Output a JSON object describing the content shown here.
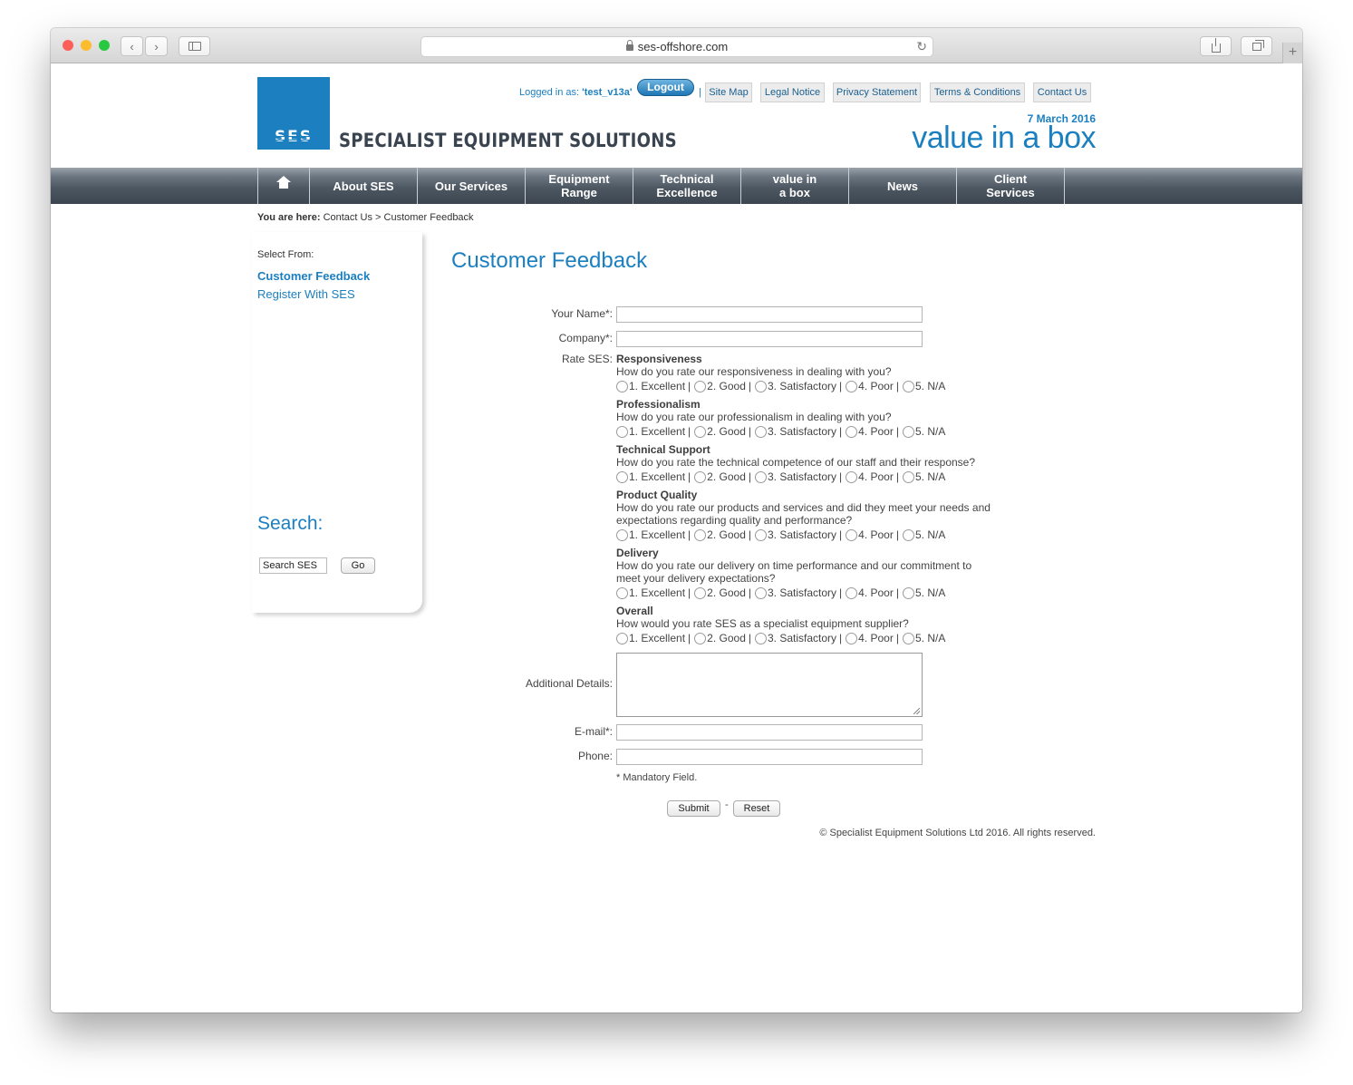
{
  "browser": {
    "url": "ses-offshore.com",
    "traffic_colors": [
      "#fc5f57",
      "#fdbc2e",
      "#28c840"
    ]
  },
  "header": {
    "logo_text": "SES",
    "brand_name": "SPECIALIST EQUIPMENT SOLUTIONS",
    "logged_in_prefix": "Logged in as: ",
    "logged_in_user": "'test_v13a'",
    "logout_label": "Logout",
    "separator": "|",
    "top_links": [
      "Site Map",
      "Legal Notice",
      "Privacy Statement",
      "Terms & Conditions",
      "Contact Us"
    ],
    "date": "7 March 2016",
    "tagline": "value in a box"
  },
  "nav": {
    "items": [
      "About SES",
      "Our Services",
      "Equipment Range",
      "Technical Excellence",
      "value in a box",
      "News",
      "Client Services"
    ]
  },
  "breadcrumb": {
    "prefix": "You are here:",
    "path": "Contact Us > Customer Feedback"
  },
  "sidebar": {
    "select_label": "Select From:",
    "links": [
      "Customer Feedback",
      "Register With SES"
    ],
    "search_title": "Search:",
    "search_value": "Search SES",
    "go_label": "Go"
  },
  "form": {
    "title": "Customer Feedback",
    "labels": {
      "name": "Your Name*:",
      "company": "Company*:",
      "rate": "Rate SES:",
      "details": "Additional Details:",
      "email": "E-mail*:",
      "phone": "Phone:"
    },
    "rating_options": [
      "1. Excellent",
      "2. Good",
      "3. Satisfactory",
      "4. Poor",
      "5. N/A"
    ],
    "ratings": [
      {
        "title": "Responsiveness",
        "question": "How do you rate our responsiveness in dealing with you?"
      },
      {
        "title": "Professionalism",
        "question": "How do you rate our professionalism in dealing with you?"
      },
      {
        "title": "Technical Support",
        "question": "How do you rate the technical competence of our staff and their response?"
      },
      {
        "title": "Product Quality",
        "question": "How do you rate our products and services and did they meet your needs and expectations regarding quality and performance?"
      },
      {
        "title": "Delivery",
        "question": "How do you rate our delivery on time performance and our commitment to meet your delivery expectations?"
      },
      {
        "title": "Overall",
        "question": "How would you rate SES as a specialist equipment supplier?"
      }
    ],
    "mandatory_note": "* Mandatory Field.",
    "submit_label": "Submit",
    "dash": "-",
    "reset_label": "Reset"
  },
  "footer": {
    "copyright": "© Specialist Equipment Solutions Ltd 2016. All rights reserved."
  }
}
